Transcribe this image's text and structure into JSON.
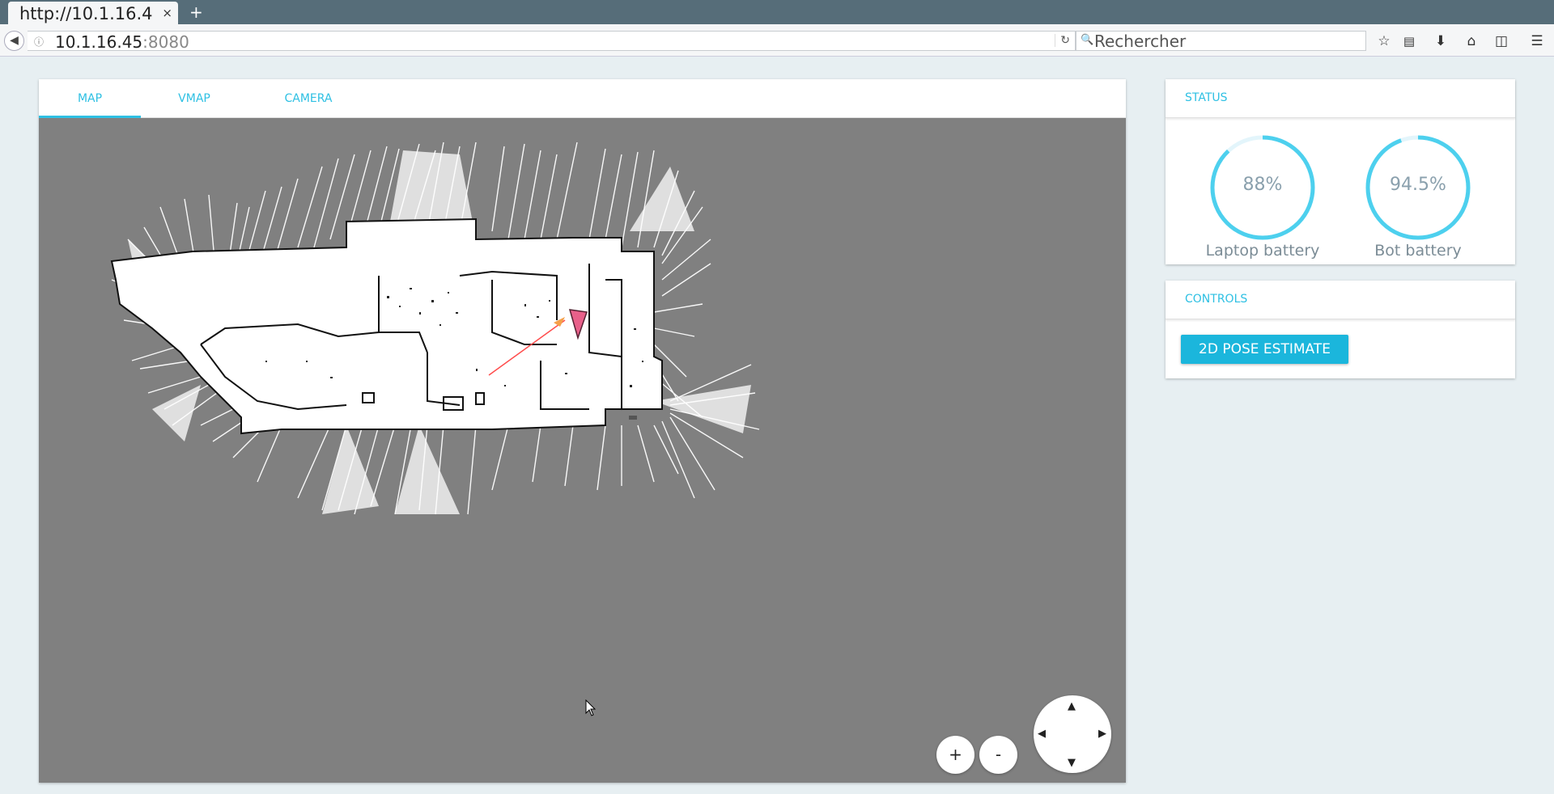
{
  "browser": {
    "tab_title": "http://10.1.16.4",
    "tab_close": "×",
    "new_tab": "+",
    "url_host": "10.1.16.45",
    "url_port": ":8080",
    "search_placeholder": "Rechercher"
  },
  "tabs": [
    {
      "label": "MAP",
      "active": true
    },
    {
      "label": "VMAP",
      "active": false
    },
    {
      "label": "CAMERA",
      "active": false
    }
  ],
  "map": {
    "zoom_in_label": "+",
    "zoom_out_label": "-",
    "robot_color": "#e8608a",
    "path_color": "#ff4d4d",
    "goal_color": "#f5a04a"
  },
  "status": {
    "title": "STATUS",
    "gauges": [
      {
        "value": "88%",
        "label": "Laptop battery",
        "fraction": 0.88
      },
      {
        "value": "94.5%",
        "label": "Bot battery",
        "fraction": 0.945
      }
    ]
  },
  "controls": {
    "title": "CONTROLS",
    "pose_button": "2D POSE ESTIMATE"
  },
  "colors": {
    "accent": "#2ec0e3",
    "gauge_track": "#e3f5fb",
    "map_background": "#808080"
  }
}
